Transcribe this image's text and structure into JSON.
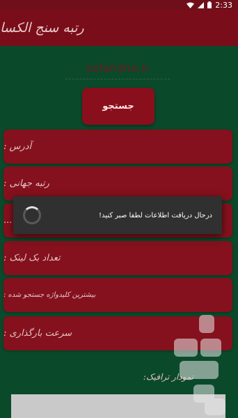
{
  "status_bar": {
    "time": "2:33"
  },
  "app_bar": {
    "title": "رتبه سنج الکسا"
  },
  "search": {
    "placeholder": "esfandne.ir",
    "value": "",
    "button_label": "جستجو"
  },
  "cards": [
    {
      "label": "آدرس :"
    },
    {
      "label": "رتبه جهانی :"
    },
    {
      "label": "رتبه ..."
    },
    {
      "label": "تعداد بک لینک :"
    },
    {
      "label": "بیشترین کلیدواژه جستجو شده :"
    },
    {
      "label": "سرعت بارگذاری :"
    }
  ],
  "chart": {
    "label": "نمودار ترافیک:"
  },
  "dialog": {
    "message": "درحال دریافت اطلاعات لطفا صبر کنید!"
  },
  "colors": {
    "background": "#0a4a2b",
    "app_bar": "#7a0d1a",
    "card": "#84111d",
    "button": "#8a0f1c"
  }
}
